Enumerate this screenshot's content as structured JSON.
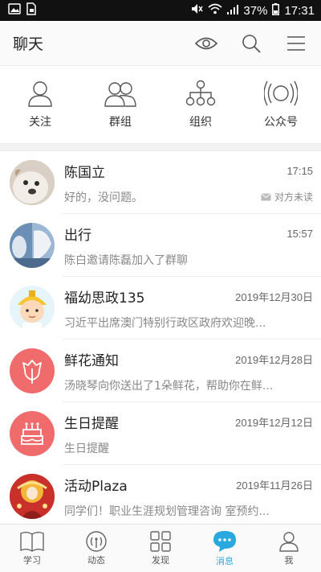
{
  "status_bar": {
    "battery": "37%",
    "time": "17:31"
  },
  "header": {
    "title": "聊天"
  },
  "shortcuts": [
    {
      "label": "关注",
      "icon": "person-icon"
    },
    {
      "label": "群组",
      "icon": "group-icon"
    },
    {
      "label": "组织",
      "icon": "org-chart-icon"
    },
    {
      "label": "公众号",
      "icon": "broadcast-icon"
    }
  ],
  "chats": [
    {
      "name": "陈国立",
      "time": "17:15",
      "preview": "好的，没问题。",
      "status": "对方未读"
    },
    {
      "name": "出行",
      "time": "15:57",
      "preview": "陈白邀请陈磊加入了群聊"
    },
    {
      "name": "福幼思政135",
      "time": "2019年12月30日",
      "preview": "习近平出席澳门特别行政区政府欢迎晚..."
    },
    {
      "name": "鲜花通知",
      "time": "2019年12月28日",
      "preview": "汤晓琴向你送出了1朵鲜花，帮助你在鲜..."
    },
    {
      "name": "生日提醒",
      "time": "2019年12月12日",
      "preview": "生日提醒"
    },
    {
      "name": "活动Plaza",
      "time": "2019年11月26日",
      "preview": "同学们！职业生涯规划管理咨询 室预约..."
    }
  ],
  "bottom_nav": [
    {
      "label": "学习",
      "icon": "book-icon"
    },
    {
      "label": "动态",
      "icon": "signal-icon"
    },
    {
      "label": "发现",
      "icon": "grid-icon"
    },
    {
      "label": "消息",
      "icon": "message-icon",
      "active": true
    },
    {
      "label": "我",
      "icon": "profile-icon"
    }
  ],
  "colors": {
    "accent": "#29a9e0",
    "flower": "#f06b6b",
    "birthday": "#f06b6b"
  }
}
